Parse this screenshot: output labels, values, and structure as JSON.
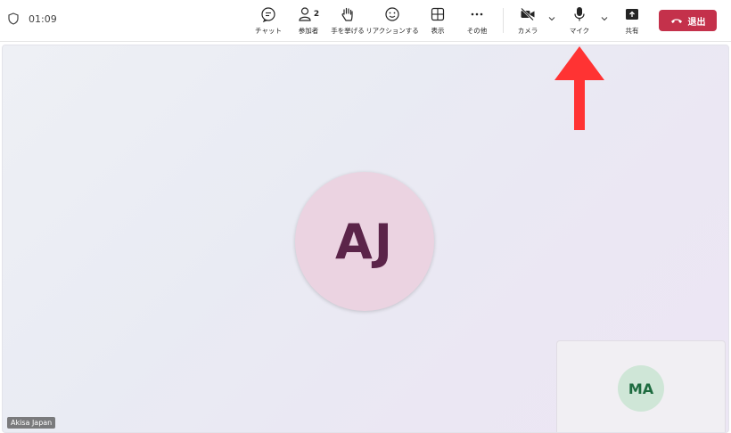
{
  "meeting": {
    "elapsed_time": "01:09"
  },
  "toolbar": {
    "chat_label": "チャット",
    "participants_label": "参加者",
    "participants_count": "2",
    "raise_hand_label": "手を挙げる",
    "react_label": "リアクションする",
    "view_label": "表示",
    "more_label": "その他",
    "camera_label": "カメラ",
    "mic_label": "マイク",
    "share_label": "共有",
    "leave_label": "退出"
  },
  "stage": {
    "main_participant": {
      "initials": "AJ",
      "name": "Akisa Japan"
    },
    "pip_participant": {
      "initials": "MA"
    }
  },
  "colors": {
    "leave_button": "#c4314b",
    "main_avatar_bg": "#ebd3e1",
    "main_avatar_text": "#5b2449",
    "pip_avatar_bg": "#cfe6d7",
    "pip_avatar_text": "#1d6b3f",
    "annotation_arrow": "#ff3333"
  }
}
